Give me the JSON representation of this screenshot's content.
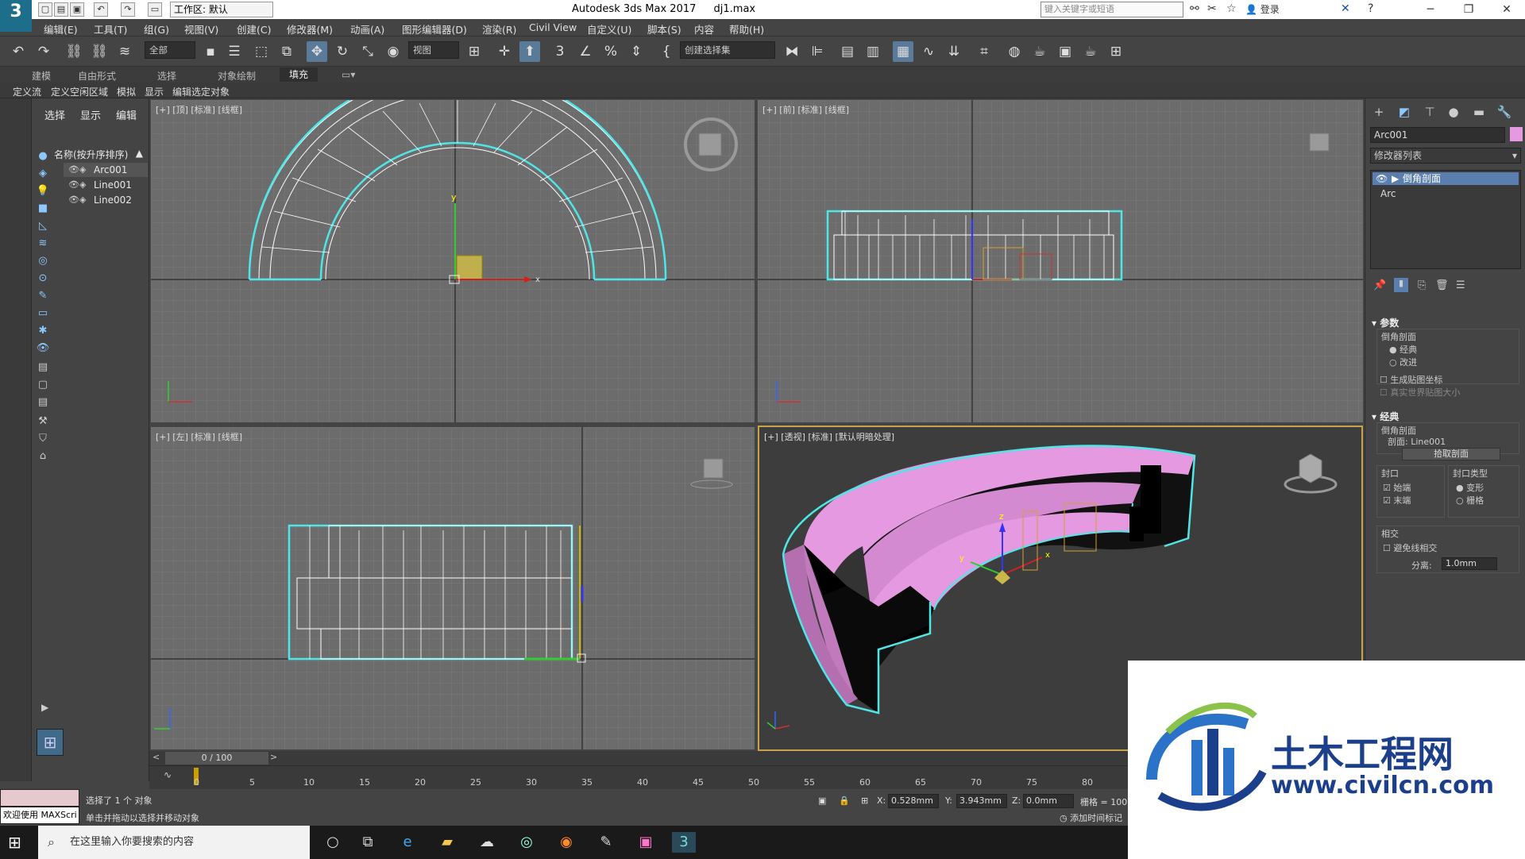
{
  "titlebar": {
    "app_logo": "3",
    "workspace": "工作区: 默认",
    "title": "Autodesk 3ds Max 2017",
    "file": "dj1.max",
    "search_placeholder": "键入关键字或短语",
    "login": "登录",
    "minimize": "─",
    "maximize": "❐",
    "close": "✕"
  },
  "menu": [
    "编辑(E)",
    "工具(T)",
    "组(G)",
    "视图(V)",
    "创建(C)",
    "修改器(M)",
    "动画(A)",
    "图形编辑器(D)",
    "渲染(R)",
    "Civil View",
    "自定义(U)",
    "脚本(S)",
    "内容",
    "帮助(H)"
  ],
  "toolbar": {
    "selection_filter": "全部",
    "ref_coord": "视图",
    "named_selection": "创建选择集"
  },
  "ribbon_tabs": [
    "建模",
    "自由形式",
    "选择",
    "对象绘制",
    "填充"
  ],
  "ribbon_active": "填充",
  "subribbon": [
    "定义流",
    "定义空闲区域",
    "模拟",
    "显示",
    "编辑选定对象"
  ],
  "scene_explorer": {
    "tabs": [
      "选择",
      "显示",
      "编辑"
    ],
    "column": "名称(按升序排序)",
    "sort_arrow": "▲",
    "items": [
      {
        "name": "Arc001",
        "selected": true
      },
      {
        "name": "Line001",
        "selected": false
      },
      {
        "name": "Line002",
        "selected": false
      }
    ]
  },
  "viewports": {
    "top": "[+] [顶] [标准] [线框]",
    "front": "[+] [前] [标准] [线框]",
    "left": "[+] [左] [标准] [线框]",
    "perspective": "[+] [透视] [标准] [默认明暗处理]"
  },
  "command_panel": {
    "object_name": "Arc001",
    "object_color": "#e599e0",
    "modifier_list": "修改器列表",
    "stack": [
      "倒角剖面",
      "Arc"
    ],
    "params_title": "参数",
    "bevel_profile": "倒角剖面",
    "classic": "经典",
    "improved": "改进",
    "gen_map": "生成贴图坐标",
    "real_world": "真实世界贴图大小",
    "classic_title": "经典",
    "bevel_profile2": "倒角剖面",
    "profile_label": "剖面:",
    "profile_value": "Line001",
    "pick_profile": "拾取剖面",
    "cap_title": "封口",
    "cap_type_title": "封口类型",
    "cap_start": "始端",
    "cap_end": "末端",
    "morph": "变形",
    "grid": "栅格",
    "intersect_title": "相交",
    "avoid_self": "避免线相交",
    "sep_label": "分离:",
    "sep_value": "1.0mm"
  },
  "timeline": {
    "frame": "0 / 100",
    "ticks": [
      "0",
      "5",
      "10",
      "15",
      "20",
      "25",
      "30",
      "35",
      "40",
      "45",
      "50",
      "55",
      "60",
      "65",
      "70",
      "75",
      "80"
    ]
  },
  "status": {
    "selected": "选择了 1 个 对象",
    "hint": "单击并拖动以选择并移动对象",
    "x_label": "X:",
    "x_value": "0.528mm",
    "y_label": "Y:",
    "y_value": "3.943mm",
    "z_label": "Z:",
    "z_value": "0.0mm",
    "grid": "栅格 = 100.0",
    "add_time_tag": "添加时间标记"
  },
  "maxscript": {
    "welcome": "欢迎使用 MAXScri"
  },
  "taskbar": {
    "search_placeholder": "在这里输入你要搜索的内容"
  },
  "watermark": {
    "title": "土木工程网",
    "url": "www.civilcn.com"
  }
}
